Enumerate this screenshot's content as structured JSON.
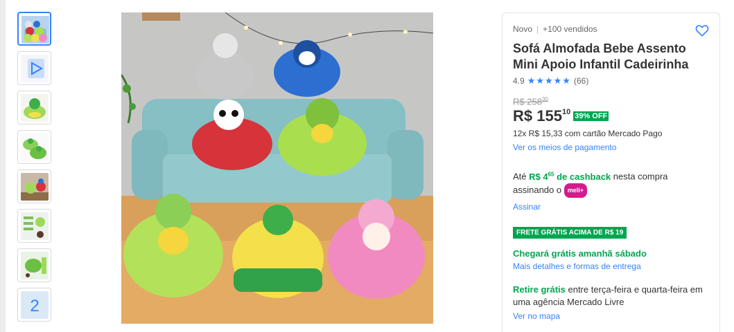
{
  "thumbnails": [
    {
      "name": "thumb-seats-group",
      "color": "#b7d3f0"
    },
    {
      "name": "thumb-video",
      "color": "#f4f6fb"
    },
    {
      "name": "thumb-green-seat",
      "color": "#9fd95a"
    },
    {
      "name": "thumb-green-seats",
      "color": "#8ccf56"
    },
    {
      "name": "thumb-room",
      "color": "#c9b8a5"
    },
    {
      "name": "thumb-details",
      "color": "#eef2ee"
    },
    {
      "name": "thumb-dimensions",
      "color": "#e9f3e6"
    },
    {
      "name": "thumb-number-2",
      "color": "#dbe9f7"
    }
  ],
  "thumb_number": "2",
  "product": {
    "condition": "Novo",
    "sold": "+100 vendidos",
    "title": "Sofá Almofada Bebe Assento Mini Apoio Infantil Cadeirinha",
    "rating_value": "4.9",
    "stars": "★★★★★",
    "reviews": "(66)",
    "old_price_int": "R$ 258",
    "old_price_cents": "30",
    "price_int": "R$ 155",
    "price_cents": "10",
    "discount": "39% OFF",
    "installments": "12x R$ 15,33 com cartão Mercado Pago",
    "payment_link": "Ver os meios de pagamento"
  },
  "cashback": {
    "prefix": "Até ",
    "highlight": "R$ 4",
    "highlight_cents": "65",
    "highlight_suffix": " de cashback",
    "mid": " nesta compra assinando o ",
    "badge": "meli+",
    "subscribe_link": "Assinar"
  },
  "shipping": {
    "free_badge": "FRETE GRÁTIS ACIMA DE R$ 19",
    "arrive": "Chegará grátis amanhã sábado",
    "details_link": "Mais detalhes e formas de entrega",
    "pickup_highlight": "Retire grátis",
    "pickup_text": " entre terça-feira e quarta-feira em uma agência Mercado Livre",
    "map_link": "Ver no mapa"
  },
  "colors": {
    "accent": "#3483fa",
    "green": "#00a650",
    "meli": "#d31b8d"
  }
}
